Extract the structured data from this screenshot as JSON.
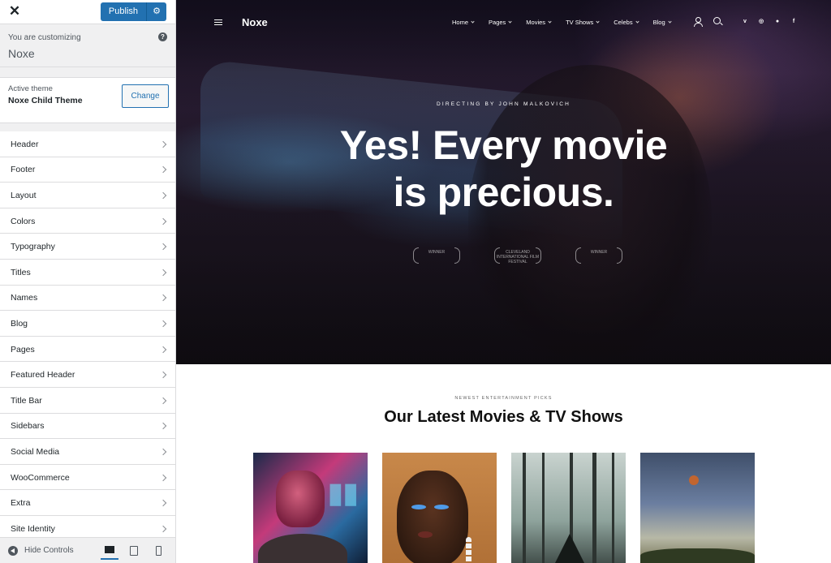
{
  "sidebar": {
    "close_icon": "close-icon",
    "publish_label": "Publish",
    "customizing_label": "You are customizing",
    "site_name": "Noxe",
    "active_theme_label": "Active theme",
    "active_theme_name": "Noxe Child Theme",
    "change_label": "Change",
    "panels": [
      "Header",
      "Footer",
      "Layout",
      "Colors",
      "Typography",
      "Titles",
      "Names",
      "Blog",
      "Pages",
      "Featured Header",
      "Title Bar",
      "Sidebars",
      "Social Media",
      "WooCommerce",
      "Extra",
      "Site Identity"
    ],
    "hide_controls_label": "Hide Controls",
    "devices": [
      "desktop",
      "tablet",
      "mobile"
    ]
  },
  "preview": {
    "logo": "Noxe",
    "menu": [
      "Home",
      "Pages",
      "Movies",
      "TV Shows",
      "Celebs",
      "Blog"
    ],
    "socials": [
      "v",
      "◎",
      "●",
      "f"
    ],
    "hero_kicker": "DIRECTING BY JOHN MALKOVICH",
    "hero_title_line1": "Yes! Every movie",
    "hero_title_line2": "is precious.",
    "awards": [
      "WINNER",
      "CLEVELAND INTERNATIONAL FILM FESTIVAL",
      "WINNER"
    ],
    "section_kicker": "NEWEST ENTERTAINMENT PICKS",
    "section_title": "Our Latest Movies & TV Shows"
  },
  "colors": {
    "accent": "#2271b1",
    "sidebar_bg": "#f0f0f1",
    "hero_bg": "#1c1520"
  }
}
